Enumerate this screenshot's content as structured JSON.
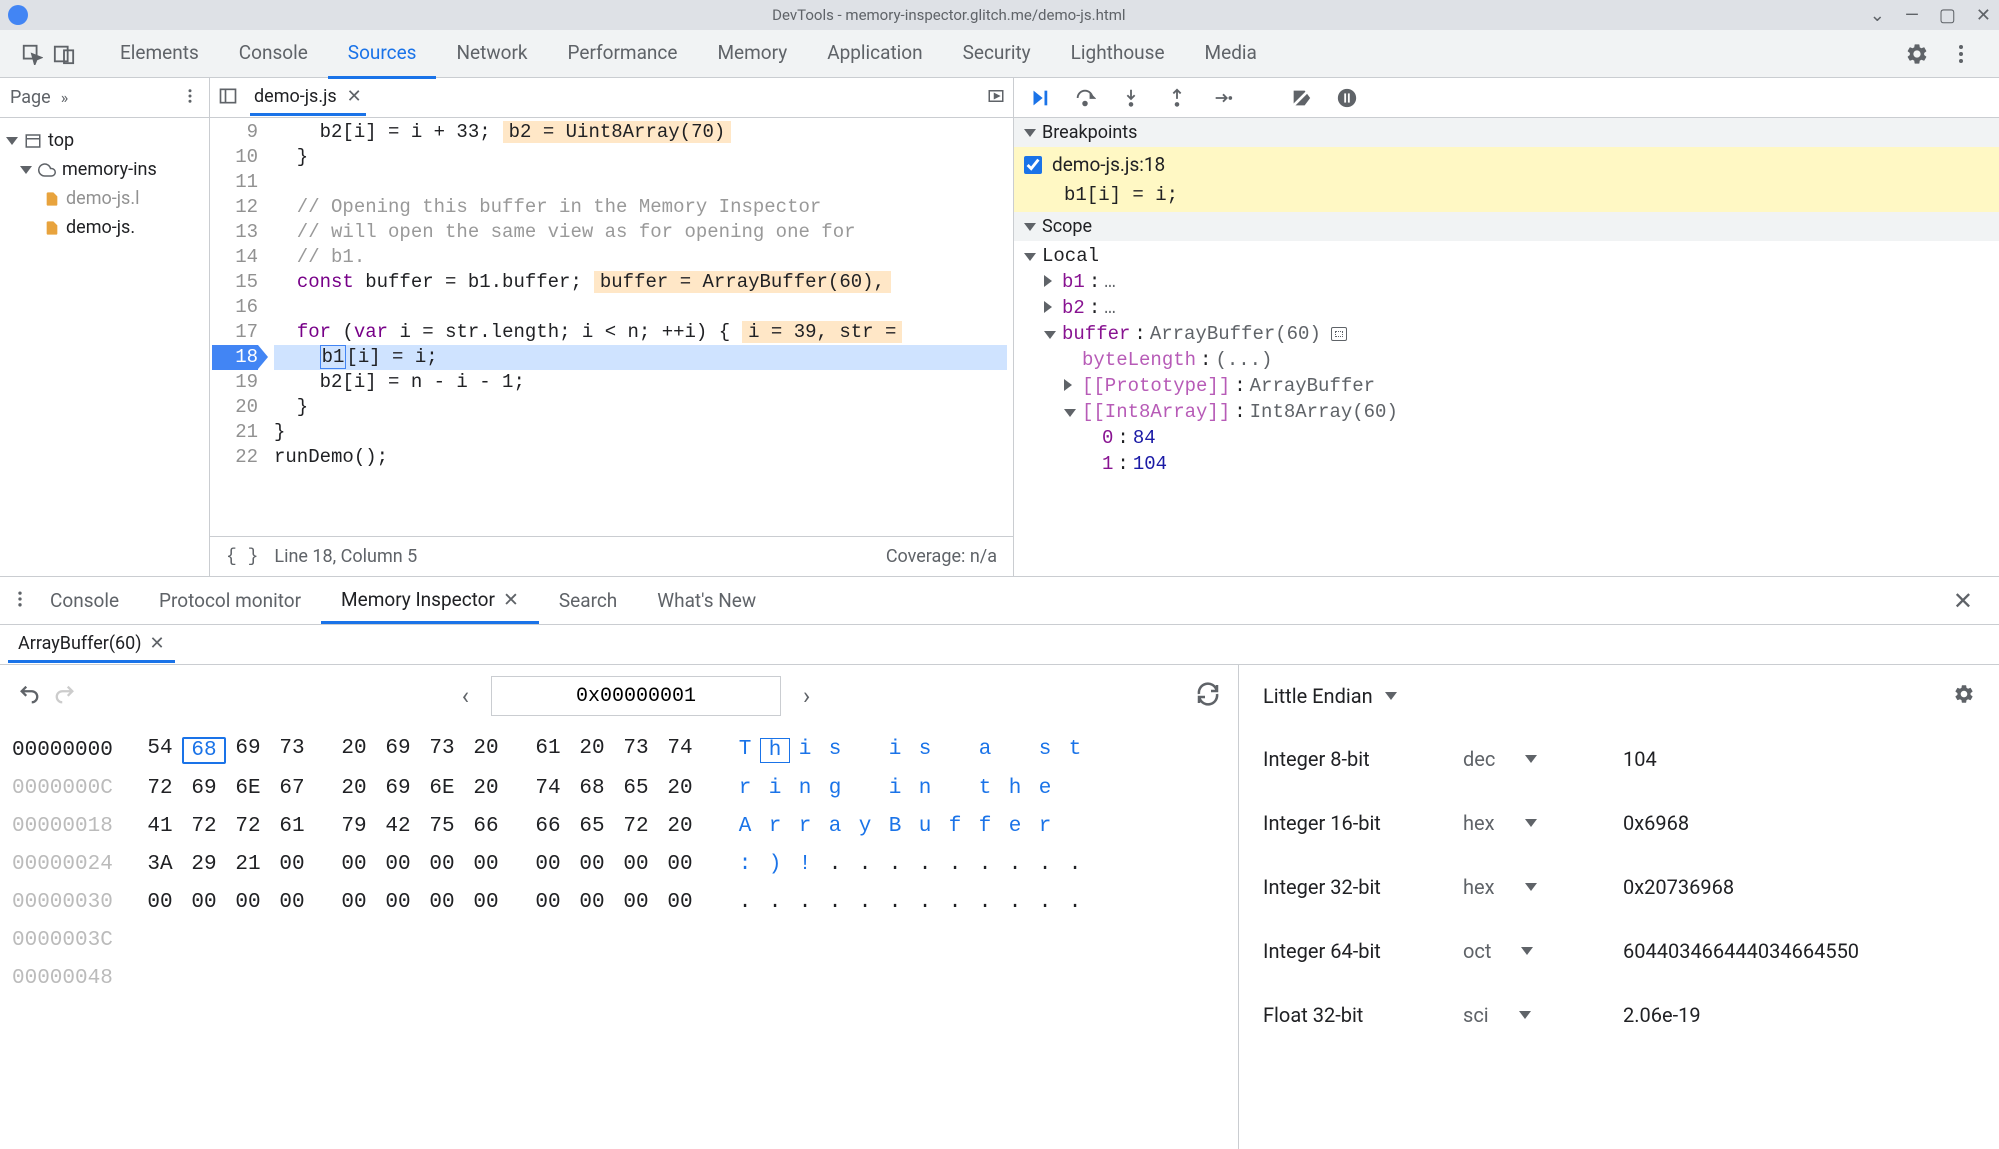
{
  "window": {
    "title": "DevTools - memory-inspector.glitch.me/demo-js.html"
  },
  "main_tabs": [
    "Elements",
    "Console",
    "Sources",
    "Network",
    "Performance",
    "Memory",
    "Application",
    "Security",
    "Lighthouse",
    "Media"
  ],
  "main_tabs_active": "Sources",
  "nav": {
    "page_tab": "Page",
    "top": "top",
    "domain": "memory-ins",
    "files": [
      "demo-js.l",
      "demo-js."
    ]
  },
  "editor": {
    "filename": "demo-js.js",
    "lines_start": 9,
    "lines": [
      {
        "n": 9,
        "text": "    b2[i] = i + 33;",
        "hint": "b2 = Uint8Array(70)"
      },
      {
        "n": 10,
        "text": "  }"
      },
      {
        "n": 11,
        "text": ""
      },
      {
        "n": 12,
        "text": "  // Opening this buffer in the Memory Inspector",
        "comment": true
      },
      {
        "n": 13,
        "text": "  // will open the same view as for opening one for",
        "comment": true
      },
      {
        "n": 14,
        "text": "  // b1.",
        "comment": true
      },
      {
        "n": 15,
        "text": "  const buffer = b1.buffer;",
        "hint": "buffer = ArrayBuffer(60),"
      },
      {
        "n": 16,
        "text": ""
      },
      {
        "n": 17,
        "text": "  for (var i = str.length; i < n; ++i) {",
        "hint": "i = 39, str ="
      },
      {
        "n": 18,
        "text": "    b1[i] = i;",
        "bp": true,
        "hl": true
      },
      {
        "n": 19,
        "text": "    b2[i] = n - i - 1;"
      },
      {
        "n": 20,
        "text": "  }"
      },
      {
        "n": 21,
        "text": "}"
      },
      {
        "n": 22,
        "text": "runDemo();"
      }
    ],
    "status_line": "Line 18, Column 5",
    "coverage": "Coverage: n/a"
  },
  "debugger": {
    "breakpoints_header": "Breakpoints",
    "breakpoints": [
      {
        "file": "demo-js.js:18",
        "code": "b1[i] = i;",
        "checked": true
      }
    ],
    "scope_header": "Scope",
    "scope": {
      "local_label": "Local",
      "b1": {
        "name": "b1",
        "val": "…"
      },
      "b2": {
        "name": "b2",
        "val": "…"
      },
      "buffer": {
        "name": "buffer",
        "val": "ArrayBuffer(60)"
      },
      "byteLength": {
        "name": "byteLength",
        "val": "(...)"
      },
      "prototype": {
        "name": "[[Prototype]]",
        "val": "ArrayBuffer"
      },
      "int8": {
        "name": "[[Int8Array]]",
        "val": "Int8Array(60)"
      },
      "idx0": {
        "name": "0",
        "val": "84"
      },
      "idx1": {
        "name": "1",
        "val": "104"
      }
    }
  },
  "drawer": {
    "tabs": [
      "Console",
      "Protocol monitor",
      "Memory Inspector",
      "Search",
      "What's New"
    ],
    "active": "Memory Inspector",
    "mem_tab": "ArrayBuffer(60)",
    "address": "0x00000001",
    "hex_rows": [
      {
        "addr": "00000000",
        "dim": false,
        "bytes": [
          "54",
          "68",
          "69",
          "73",
          "20",
          "69",
          "73",
          "20",
          "61",
          "20",
          "73",
          "74"
        ],
        "ascii": [
          "T",
          "h",
          "i",
          "s",
          " ",
          "i",
          "s",
          " ",
          "a",
          " ",
          "s",
          "t"
        ],
        "sel": 1
      },
      {
        "addr": "0000000C",
        "dim": true,
        "bytes": [
          "72",
          "69",
          "6E",
          "67",
          "20",
          "69",
          "6E",
          "20",
          "74",
          "68",
          "65",
          "20"
        ],
        "ascii": [
          "r",
          "i",
          "n",
          "g",
          " ",
          "i",
          "n",
          " ",
          "t",
          "h",
          "e",
          " "
        ]
      },
      {
        "addr": "00000018",
        "dim": true,
        "bytes": [
          "41",
          "72",
          "72",
          "61",
          "79",
          "42",
          "75",
          "66",
          "66",
          "65",
          "72",
          "20"
        ],
        "ascii": [
          "A",
          "r",
          "r",
          "a",
          "y",
          "B",
          "u",
          "f",
          "f",
          "e",
          "r",
          " "
        ]
      },
      {
        "addr": "00000024",
        "dim": true,
        "bytes": [
          "3A",
          "29",
          "21",
          "00",
          "00",
          "00",
          "00",
          "00",
          "00",
          "00",
          "00",
          "00"
        ],
        "ascii": [
          ":",
          ")",
          "!",
          ".",
          ".",
          ".",
          ".",
          ".",
          ".",
          ".",
          ".",
          "."
        ]
      },
      {
        "addr": "00000030",
        "dim": true,
        "bytes": [
          "00",
          "00",
          "00",
          "00",
          "00",
          "00",
          "00",
          "00",
          "00",
          "00",
          "00",
          "00"
        ],
        "ascii": [
          ".",
          ".",
          ".",
          ".",
          ".",
          ".",
          ".",
          ".",
          ".",
          ".",
          ".",
          "."
        ]
      },
      {
        "addr": "0000003C",
        "dim": true,
        "bytes": [],
        "ascii": []
      },
      {
        "addr": "00000048",
        "dim": true,
        "bytes": [],
        "ascii": []
      }
    ],
    "endian": "Little Endian",
    "values": [
      {
        "label": "Integer 8-bit",
        "fmt": "dec",
        "val": "104"
      },
      {
        "label": "Integer 16-bit",
        "fmt": "hex",
        "val": "0x6968"
      },
      {
        "label": "Integer 32-bit",
        "fmt": "hex",
        "val": "0x20736968"
      },
      {
        "label": "Integer 64-bit",
        "fmt": "oct",
        "val": "604403466444034664550"
      },
      {
        "label": "Float 32-bit",
        "fmt": "sci",
        "val": "2.06e-19"
      }
    ]
  }
}
